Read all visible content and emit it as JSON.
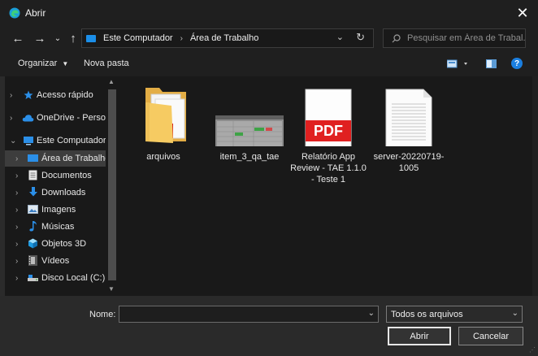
{
  "window": {
    "title": "Abrir"
  },
  "address": {
    "segments": [
      "Este Computador",
      "Área de Trabalho"
    ],
    "search_placeholder": "Pesquisar em Área de Trabal..."
  },
  "toolbar": {
    "organize": "Organizar",
    "new_folder": "Nova pasta"
  },
  "sidebar": {
    "items": [
      {
        "label": "Acesso rápido",
        "icon": "star-icon"
      },
      {
        "label": "OneDrive - Person",
        "icon": "cloud-icon"
      },
      {
        "label": "Este Computador",
        "icon": "computer-icon"
      },
      {
        "label": "Área de Trabalho",
        "icon": "desktop-icon"
      },
      {
        "label": "Documentos",
        "icon": "document-icon"
      },
      {
        "label": "Downloads",
        "icon": "download-icon"
      },
      {
        "label": "Imagens",
        "icon": "picture-icon"
      },
      {
        "label": "Músicas",
        "icon": "music-icon"
      },
      {
        "label": "Objetos 3D",
        "icon": "cube-icon"
      },
      {
        "label": "Vídeos",
        "icon": "film-icon"
      },
      {
        "label": "Disco Local (C:)",
        "icon": "drive-icon"
      }
    ]
  },
  "files": [
    {
      "name": "arquivos",
      "kind": "folder-pdf-icon"
    },
    {
      "name": "item_3_qa_tae",
      "kind": "spreadsheet-thumb-icon"
    },
    {
      "name": "Relatório App Review - TAE 1.1.0 - Teste 1",
      "kind": "pdf-icon",
      "badge": "PDF"
    },
    {
      "name": "server-20220719-1005",
      "kind": "text-file-icon"
    }
  ],
  "footer": {
    "name_label": "Nome:",
    "name_value": "",
    "filetype": "Todos os arquivos",
    "open_button": "Abrir",
    "cancel_button": "Cancelar"
  },
  "colors": {
    "accent": "#1b8ee8",
    "pdf_red": "#e02020",
    "folder": "#f3c25a"
  }
}
